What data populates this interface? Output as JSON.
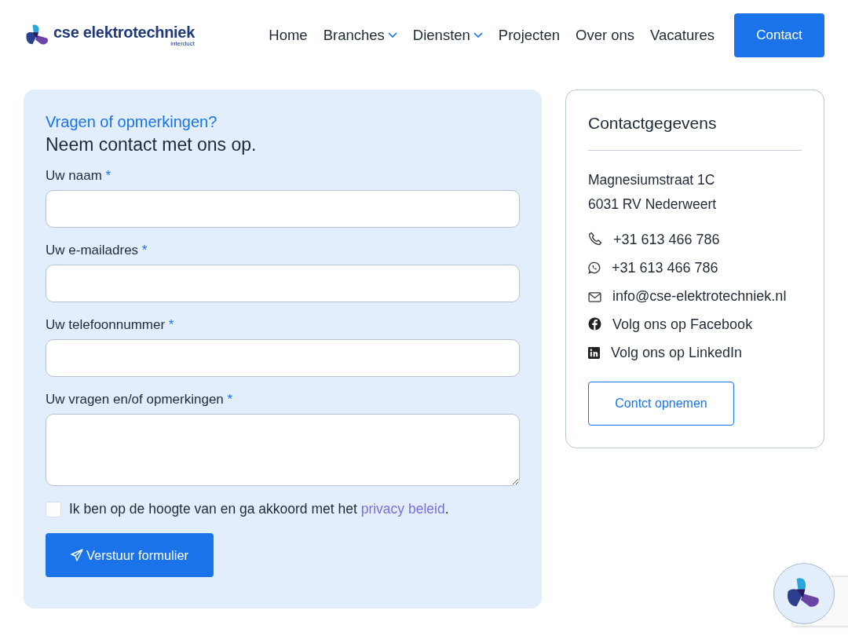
{
  "header": {
    "logo": {
      "name": "cse elektrotechniek",
      "tagline": "interduct"
    },
    "nav": [
      {
        "label": "Home",
        "dropdown": false
      },
      {
        "label": "Branches",
        "dropdown": true
      },
      {
        "label": "Diensten",
        "dropdown": true
      },
      {
        "label": "Projecten",
        "dropdown": false
      },
      {
        "label": "Over ons",
        "dropdown": false
      },
      {
        "label": "Vacatures",
        "dropdown": false
      }
    ],
    "cta": "Contact"
  },
  "form": {
    "subtitle": "Vragen of opmerkingen?",
    "title": "Neem contact met ons op.",
    "fields": [
      {
        "label": "Uw naam",
        "required_mark": "*",
        "kind": "input"
      },
      {
        "label": "Uw e-mailadres",
        "required_mark": "*",
        "kind": "input"
      },
      {
        "label": "Uw telefoonnummer",
        "required_mark": "*",
        "kind": "input"
      },
      {
        "label": "Uw vragen en/of opmerkingen",
        "required_mark": "*",
        "kind": "textarea"
      }
    ],
    "consent": {
      "checked": false,
      "text": "Ik ben op de hoogte van en ga akkoord met het ",
      "link": "privacy beleid",
      "after": "."
    },
    "submit": "Verstuur formulier"
  },
  "contact": {
    "title": "Contactgegevens",
    "address": [
      "Magnesiumstraat 1C",
      "6031 RV Nederweert"
    ],
    "items": [
      {
        "kind": "phone",
        "text": "+31 613 466 786"
      },
      {
        "kind": "whatsapp",
        "text": "+31 613 466 786"
      },
      {
        "kind": "email",
        "text": "info@cse-elektrotechniek.nl"
      },
      {
        "kind": "facebook",
        "text": "Volg ons op Facebook"
      },
      {
        "kind": "linkedin",
        "text": "Volg ons op LinkedIn"
      }
    ],
    "button": "Contct opnemen"
  }
}
